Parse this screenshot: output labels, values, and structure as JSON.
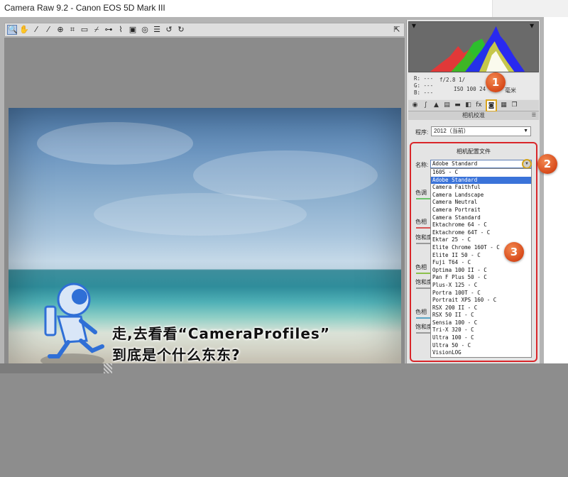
{
  "window": {
    "title": "Camera Raw 9.2 -  Canon EOS 5D Mark III"
  },
  "toolbar": {
    "tools": [
      {
        "icon": "zoom-icon",
        "glyph": "🔍"
      },
      {
        "icon": "hand-icon",
        "glyph": "✋"
      },
      {
        "icon": "white-balance-icon",
        "glyph": "⁄"
      },
      {
        "icon": "color-sampler-icon",
        "glyph": "⁄"
      },
      {
        "icon": "target-adjust-icon",
        "glyph": "⊕"
      },
      {
        "icon": "crop-icon",
        "glyph": "⌗"
      },
      {
        "icon": "straighten-icon",
        "glyph": "▭"
      },
      {
        "icon": "spot-removal-icon",
        "glyph": "⌿"
      },
      {
        "icon": "red-eye-icon",
        "glyph": "⊶"
      },
      {
        "icon": "brush-icon",
        "glyph": "⌇"
      },
      {
        "icon": "graduated-filter-icon",
        "glyph": "▣"
      },
      {
        "icon": "radial-filter-icon",
        "glyph": "◎"
      },
      {
        "icon": "preferences-icon",
        "glyph": "☰"
      },
      {
        "icon": "rotate-left-icon",
        "glyph": "↺"
      },
      {
        "icon": "rotate-right-icon",
        "glyph": "↻"
      }
    ],
    "fullscreen_glyph": "⇱"
  },
  "info": {
    "r": "R:  ---",
    "g": "G:  ---",
    "b": "B:  ---",
    "exif_line1": "f/2.8    1/",
    "exif_line2": "ISO 100   24",
    "focal_unit": "毫米"
  },
  "panel_tabs": [
    {
      "icon": "basic-icon",
      "glyph": "◉"
    },
    {
      "icon": "tone-curve-icon",
      "glyph": "∫"
    },
    {
      "icon": "detail-icon",
      "glyph": "▲"
    },
    {
      "icon": "hsl-icon",
      "glyph": "▤"
    },
    {
      "icon": "split-toning-icon",
      "glyph": "▬"
    },
    {
      "icon": "lens-corrections-icon",
      "glyph": "◧"
    },
    {
      "icon": "effects-icon",
      "glyph": "fx"
    },
    {
      "icon": "camera-calibration-icon",
      "glyph": "◙"
    },
    {
      "icon": "presets-icon",
      "glyph": "▦"
    },
    {
      "icon": "snapshots-icon",
      "glyph": "❐"
    }
  ],
  "section": {
    "title": "相机校准"
  },
  "process": {
    "label": "程序:",
    "value": "2012（当前）"
  },
  "camera_profile": {
    "title": "相机配置文件",
    "name_label": "名称:",
    "selected": "Adobe Standard",
    "options": [
      "160S - C",
      "Adobe Standard",
      "Camera Faithful",
      "Camera Landscape",
      "Camera Neutral",
      "Camera Portrait",
      "Camera Standard",
      "Ektachrome 64 - C",
      "Ektachrome 64T - C",
      "Ektar 25 - C",
      "Elite Chrome 160T - C",
      "Elite II 50 - C",
      "Fuji T64 - C",
      "Optima 100 II - C",
      "Pan F Plus 50 - C",
      "Plus-X 125 - C",
      "Portra 100T - C",
      "Portrait XPS 160 - C",
      "RSX 200 II - C",
      "RSX 50 II - C",
      "Sensia 100 - C",
      "Tri-X 320 - C",
      "Ultra 100 - C",
      "Ultra 50 - C",
      "VisionLOG"
    ]
  },
  "hidden_labels": {
    "tone": "色调",
    "hue1": "色相",
    "sat1": "饱和度",
    "hue2": "色相",
    "sat2": "饱和度",
    "hue3": "色相",
    "sat3": "饱和度"
  },
  "badges": [
    "1",
    "2",
    "3"
  ],
  "caption": {
    "line1": "走,去看看“CameraProfiles”",
    "line2": "到底是个什么东东?"
  },
  "colors": {
    "highlight_box": "#d9262a",
    "badge": "#d74a1a",
    "selected_item": "#3a73d9",
    "astronaut": "#2f6fd6"
  }
}
